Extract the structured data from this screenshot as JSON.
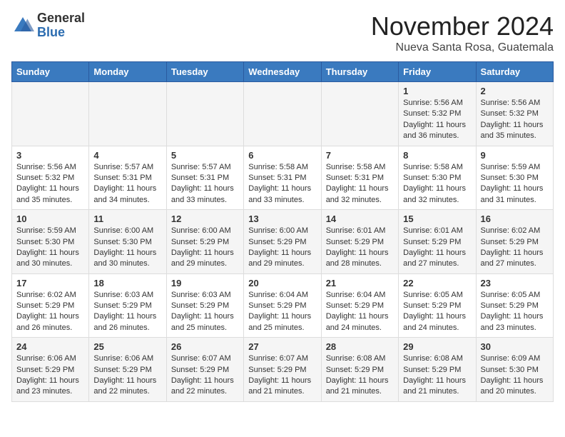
{
  "header": {
    "logo_line1": "General",
    "logo_line2": "Blue",
    "month_year": "November 2024",
    "location": "Nueva Santa Rosa, Guatemala"
  },
  "weekdays": [
    "Sunday",
    "Monday",
    "Tuesday",
    "Wednesday",
    "Thursday",
    "Friday",
    "Saturday"
  ],
  "weeks": [
    [
      {
        "day": "",
        "info": ""
      },
      {
        "day": "",
        "info": ""
      },
      {
        "day": "",
        "info": ""
      },
      {
        "day": "",
        "info": ""
      },
      {
        "day": "",
        "info": ""
      },
      {
        "day": "1",
        "info": "Sunrise: 5:56 AM\nSunset: 5:32 PM\nDaylight: 11 hours and 36 minutes."
      },
      {
        "day": "2",
        "info": "Sunrise: 5:56 AM\nSunset: 5:32 PM\nDaylight: 11 hours and 35 minutes."
      }
    ],
    [
      {
        "day": "3",
        "info": "Sunrise: 5:56 AM\nSunset: 5:32 PM\nDaylight: 11 hours and 35 minutes."
      },
      {
        "day": "4",
        "info": "Sunrise: 5:57 AM\nSunset: 5:31 PM\nDaylight: 11 hours and 34 minutes."
      },
      {
        "day": "5",
        "info": "Sunrise: 5:57 AM\nSunset: 5:31 PM\nDaylight: 11 hours and 33 minutes."
      },
      {
        "day": "6",
        "info": "Sunrise: 5:58 AM\nSunset: 5:31 PM\nDaylight: 11 hours and 33 minutes."
      },
      {
        "day": "7",
        "info": "Sunrise: 5:58 AM\nSunset: 5:31 PM\nDaylight: 11 hours and 32 minutes."
      },
      {
        "day": "8",
        "info": "Sunrise: 5:58 AM\nSunset: 5:30 PM\nDaylight: 11 hours and 32 minutes."
      },
      {
        "day": "9",
        "info": "Sunrise: 5:59 AM\nSunset: 5:30 PM\nDaylight: 11 hours and 31 minutes."
      }
    ],
    [
      {
        "day": "10",
        "info": "Sunrise: 5:59 AM\nSunset: 5:30 PM\nDaylight: 11 hours and 30 minutes."
      },
      {
        "day": "11",
        "info": "Sunrise: 6:00 AM\nSunset: 5:30 PM\nDaylight: 11 hours and 30 minutes."
      },
      {
        "day": "12",
        "info": "Sunrise: 6:00 AM\nSunset: 5:29 PM\nDaylight: 11 hours and 29 minutes."
      },
      {
        "day": "13",
        "info": "Sunrise: 6:00 AM\nSunset: 5:29 PM\nDaylight: 11 hours and 29 minutes."
      },
      {
        "day": "14",
        "info": "Sunrise: 6:01 AM\nSunset: 5:29 PM\nDaylight: 11 hours and 28 minutes."
      },
      {
        "day": "15",
        "info": "Sunrise: 6:01 AM\nSunset: 5:29 PM\nDaylight: 11 hours and 27 minutes."
      },
      {
        "day": "16",
        "info": "Sunrise: 6:02 AM\nSunset: 5:29 PM\nDaylight: 11 hours and 27 minutes."
      }
    ],
    [
      {
        "day": "17",
        "info": "Sunrise: 6:02 AM\nSunset: 5:29 PM\nDaylight: 11 hours and 26 minutes."
      },
      {
        "day": "18",
        "info": "Sunrise: 6:03 AM\nSunset: 5:29 PM\nDaylight: 11 hours and 26 minutes."
      },
      {
        "day": "19",
        "info": "Sunrise: 6:03 AM\nSunset: 5:29 PM\nDaylight: 11 hours and 25 minutes."
      },
      {
        "day": "20",
        "info": "Sunrise: 6:04 AM\nSunset: 5:29 PM\nDaylight: 11 hours and 25 minutes."
      },
      {
        "day": "21",
        "info": "Sunrise: 6:04 AM\nSunset: 5:29 PM\nDaylight: 11 hours and 24 minutes."
      },
      {
        "day": "22",
        "info": "Sunrise: 6:05 AM\nSunset: 5:29 PM\nDaylight: 11 hours and 24 minutes."
      },
      {
        "day": "23",
        "info": "Sunrise: 6:05 AM\nSunset: 5:29 PM\nDaylight: 11 hours and 23 minutes."
      }
    ],
    [
      {
        "day": "24",
        "info": "Sunrise: 6:06 AM\nSunset: 5:29 PM\nDaylight: 11 hours and 23 minutes."
      },
      {
        "day": "25",
        "info": "Sunrise: 6:06 AM\nSunset: 5:29 PM\nDaylight: 11 hours and 22 minutes."
      },
      {
        "day": "26",
        "info": "Sunrise: 6:07 AM\nSunset: 5:29 PM\nDaylight: 11 hours and 22 minutes."
      },
      {
        "day": "27",
        "info": "Sunrise: 6:07 AM\nSunset: 5:29 PM\nDaylight: 11 hours and 21 minutes."
      },
      {
        "day": "28",
        "info": "Sunrise: 6:08 AM\nSunset: 5:29 PM\nDaylight: 11 hours and 21 minutes."
      },
      {
        "day": "29",
        "info": "Sunrise: 6:08 AM\nSunset: 5:29 PM\nDaylight: 11 hours and 21 minutes."
      },
      {
        "day": "30",
        "info": "Sunrise: 6:09 AM\nSunset: 5:30 PM\nDaylight: 11 hours and 20 minutes."
      }
    ]
  ]
}
